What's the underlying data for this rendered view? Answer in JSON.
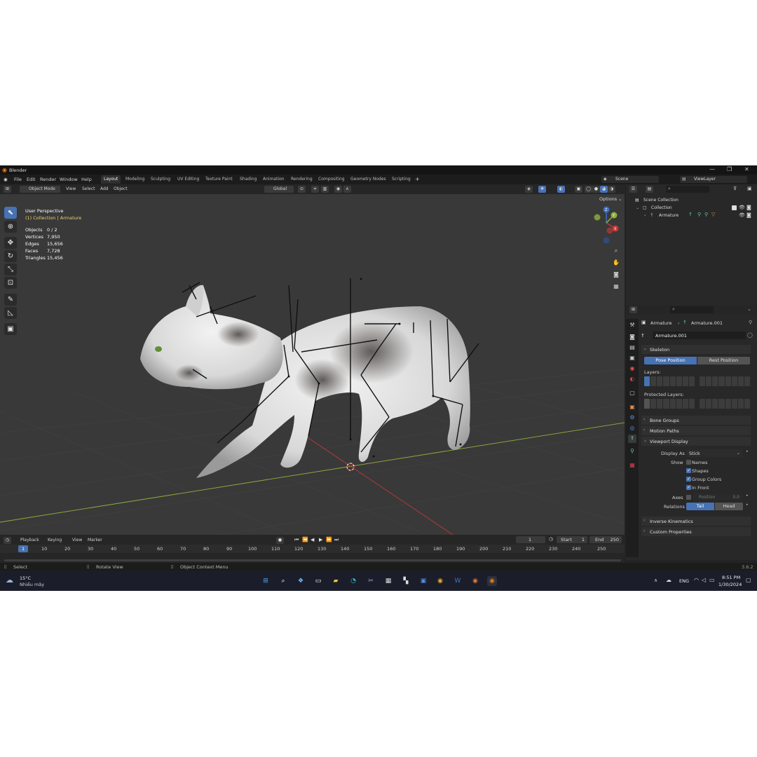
{
  "window": {
    "title": "Blender",
    "version": "3.6.2"
  },
  "menu": [
    "File",
    "Edit",
    "Render",
    "Window",
    "Help"
  ],
  "workspaces": [
    {
      "label": "Layout",
      "active": true
    },
    {
      "label": "Modeling"
    },
    {
      "label": "Sculpting"
    },
    {
      "label": "UV Editing"
    },
    {
      "label": "Texture Paint"
    },
    {
      "label": "Shading"
    },
    {
      "label": "Animation"
    },
    {
      "label": "Rendering"
    },
    {
      "label": "Compositing"
    },
    {
      "label": "Geometry Nodes"
    },
    {
      "label": "Scripting"
    }
  ],
  "scene": {
    "label": "Scene",
    "view_layer": "ViewLayer"
  },
  "viewport_header": {
    "mode": "Object Mode",
    "menus": [
      "View",
      "Select",
      "Add",
      "Object"
    ],
    "orientation": "Global",
    "options": "Options"
  },
  "viewport_overlay": {
    "perspective": "User Perspective",
    "collection": "(1) Collection | Armature",
    "stats": [
      {
        "label": "Objects",
        "value": "0 / 2"
      },
      {
        "label": "Vertices",
        "value": "7,950"
      },
      {
        "label": "Edges",
        "value": "15,656"
      },
      {
        "label": "Faces",
        "value": "7,728"
      },
      {
        "label": "Triangles",
        "value": "15,456"
      }
    ]
  },
  "gizmo": {
    "x": "X",
    "y": "Y",
    "z": "Z"
  },
  "outliner": {
    "scene_collection": "Scene Collection",
    "collection": "Collection",
    "armature": "Armature"
  },
  "properties": {
    "breadcrumb_obj": "Armature",
    "breadcrumb_data": "Armature.001",
    "data_name": "Armature.001",
    "skeleton": {
      "title": "Skeleton",
      "pose_position": "Pose Position",
      "rest_position": "Rest Position",
      "layers": "Layers:",
      "protected_layers": "Protected Layers:"
    },
    "bone_groups": "Bone Groups",
    "motion_paths": "Motion Paths",
    "viewport_display": {
      "title": "Viewport Display",
      "display_as_label": "Display As",
      "display_as_value": "Stick",
      "show_label": "Show",
      "names": "Names",
      "shapes": "Shapes",
      "group_colors": "Group Colors",
      "in_front": "In Front",
      "axes_label": "Axes",
      "position_label": "Position",
      "position_value": "0.0",
      "relations_label": "Relations",
      "tail": "Tail",
      "head": "Head"
    },
    "inverse_kinematics": "Inverse Kinematics",
    "custom_properties": "Custom Properties"
  },
  "timeline": {
    "menus": [
      "Playback",
      "Keying",
      "View",
      "Marker"
    ],
    "current_frame": "1",
    "start_label": "Start",
    "start": "1",
    "end_label": "End",
    "end": "250",
    "ticks": [
      "1",
      "10",
      "20",
      "30",
      "40",
      "50",
      "60",
      "70",
      "80",
      "90",
      "100",
      "110",
      "120",
      "130",
      "140",
      "150",
      "160",
      "170",
      "180",
      "190",
      "200",
      "210",
      "220",
      "230",
      "240",
      "250"
    ]
  },
  "status_bar": {
    "select": "Select",
    "rotate": "Rotate View",
    "context_menu": "Object Context Menu",
    "version": "3.6.2"
  },
  "taskbar": {
    "weather_temp": "15°C",
    "weather_desc": "Nhiều mây",
    "lang": "ENG",
    "time": "8:51 PM",
    "date": "1/30/2024"
  },
  "colors": {
    "accent": "#4772b3",
    "viewport_bg": "#393939",
    "x_axis": "#c0393b",
    "y_axis": "#8fb13b"
  }
}
